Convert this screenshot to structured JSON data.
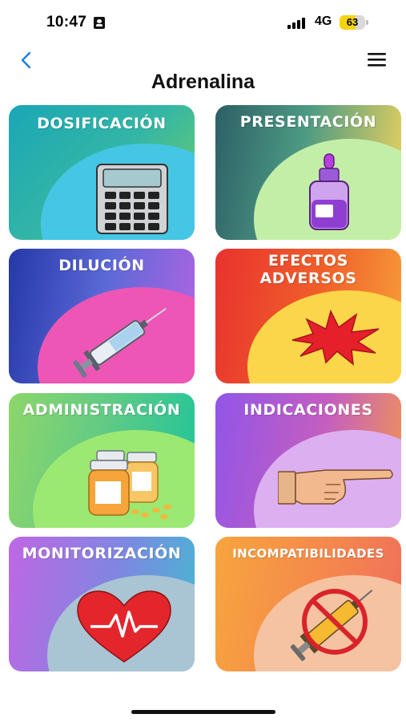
{
  "status": {
    "time": "10:47",
    "network": "4G",
    "battery": "63",
    "battery_level": 0.63
  },
  "header": {
    "title": "Adrenalina",
    "back_icon": "chevron-left-icon",
    "menu_icon": "hamburger-menu-icon"
  },
  "cards": [
    {
      "id": "dosificacion",
      "label": "DOSIFICACIÓN",
      "icon": "calculator-icon"
    },
    {
      "id": "presentacion",
      "label": "PRESENTACIÓN",
      "icon": "dropper-bottle-icon"
    },
    {
      "id": "dilucion",
      "label": "DILUCIÓN",
      "icon": "syringe-icon"
    },
    {
      "id": "efectos-adversos",
      "label_line1": "EFECTOS",
      "label_line2": "ADVERSOS",
      "icon": "explosion-icon"
    },
    {
      "id": "administracion",
      "label": "ADMINISTRACIÓN",
      "icon": "pill-bottles-icon"
    },
    {
      "id": "indicaciones",
      "label": "INDICACIONES",
      "icon": "pointing-hand-icon"
    },
    {
      "id": "monitorizacion",
      "label": "MONITORIZACIÓN",
      "icon": "heart-pulse-icon"
    },
    {
      "id": "incompatibilidades",
      "label": "INCOMPATIBILIDADES",
      "icon": "prohibited-syringe-icon"
    }
  ]
}
